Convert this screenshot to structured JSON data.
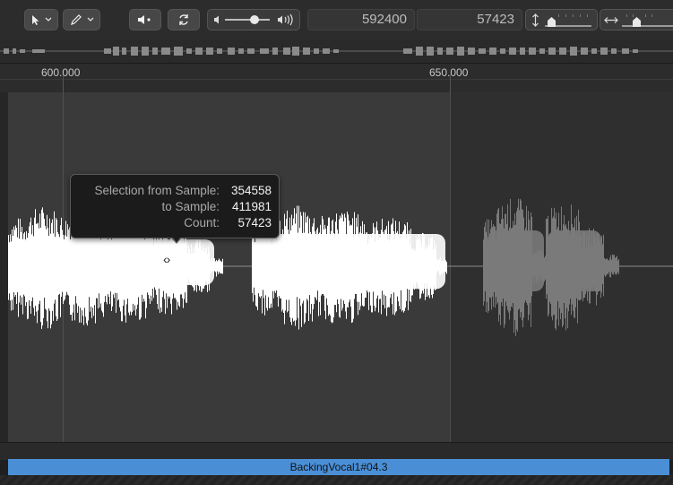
{
  "toolbar": {
    "pointer_tool": {
      "icon": "arrow-pointer-icon",
      "chevron": "chevron-down-icon"
    },
    "pencil_tool": {
      "icon": "pencil-icon",
      "chevron": "chevron-down-icon"
    },
    "speaker_button": {
      "icon": "speaker-preview-icon"
    },
    "cycle_button": {
      "icon": "cycle-loop-icon"
    },
    "volume": {
      "min_icon": "speaker-low-icon",
      "max_icon": "speaker-high-icon",
      "level": 0.55
    },
    "position_counter": "592400",
    "length_counter": "57423",
    "vertical_zoom": {
      "icon": "vertical-zoom-icon",
      "level": 0.15
    },
    "horizontal_zoom": {
      "icon": "horizontal-zoom-icon",
      "level": 0.3
    }
  },
  "ruler": {
    "labels": [
      "600.000",
      "650.000"
    ]
  },
  "tooltip": {
    "rows": [
      {
        "label": "Selection from Sample:",
        "value": "354558"
      },
      {
        "label": "to Sample:",
        "value": "411981"
      },
      {
        "label": "Count:",
        "value": "57423"
      }
    ]
  },
  "region": {
    "name": "BackingVocal1#04.3",
    "color": "#4a8fd6"
  },
  "colors": {
    "selected_waveform": "#ffffff",
    "unselected_waveform": "#7a7a7a",
    "editor_bg": "#3a3a3a"
  }
}
